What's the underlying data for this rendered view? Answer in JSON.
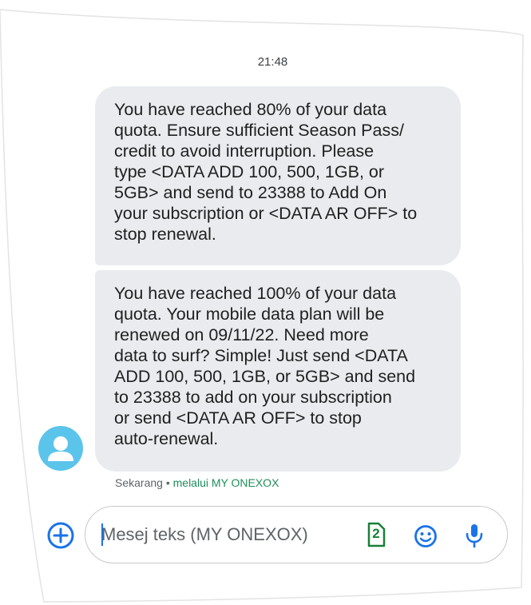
{
  "conversation": {
    "timestamp": "21:48",
    "messages": [
      {
        "text": "You have reached 80% of your data\nquota. Ensure sufficient Season Pass/\ncredit to avoid interruption. Please\ntype <DATA ADD 100, 500, 1GB, or\n5GB> and send to 23388 to Add On\nyour subscription or <DATA AR OFF> to\nstop renewal."
      },
      {
        "text": "You have reached 100% of your data\nquota. Your mobile data plan will be\nrenewed on 09/11/22. Need more\ndata to surf? Simple! Just send <DATA\nADD 100, 500, 1GB, or 5GB> and send\nto 23388 to add on your subscription\nor send <DATA AR OFF> to stop\nauto-renewal."
      }
    ],
    "status": {
      "time": "Sekarang",
      "separator": " • ",
      "via": "melalui MY ONEXOX"
    }
  },
  "composer": {
    "placeholder": "Mesej teks (MY ONEXOX)",
    "sim_number": "2"
  },
  "icons": {
    "add": "add-circle-icon",
    "sim": "sim-card-icon",
    "emoji": "emoji-icon",
    "mic": "microphone-icon",
    "avatar": "person-icon"
  },
  "colors": {
    "accent": "#1a73e8",
    "bubble": "#e9ebee",
    "avatar": "#5bc4ea",
    "sim": "#188038",
    "via": "#1e8e5a"
  }
}
